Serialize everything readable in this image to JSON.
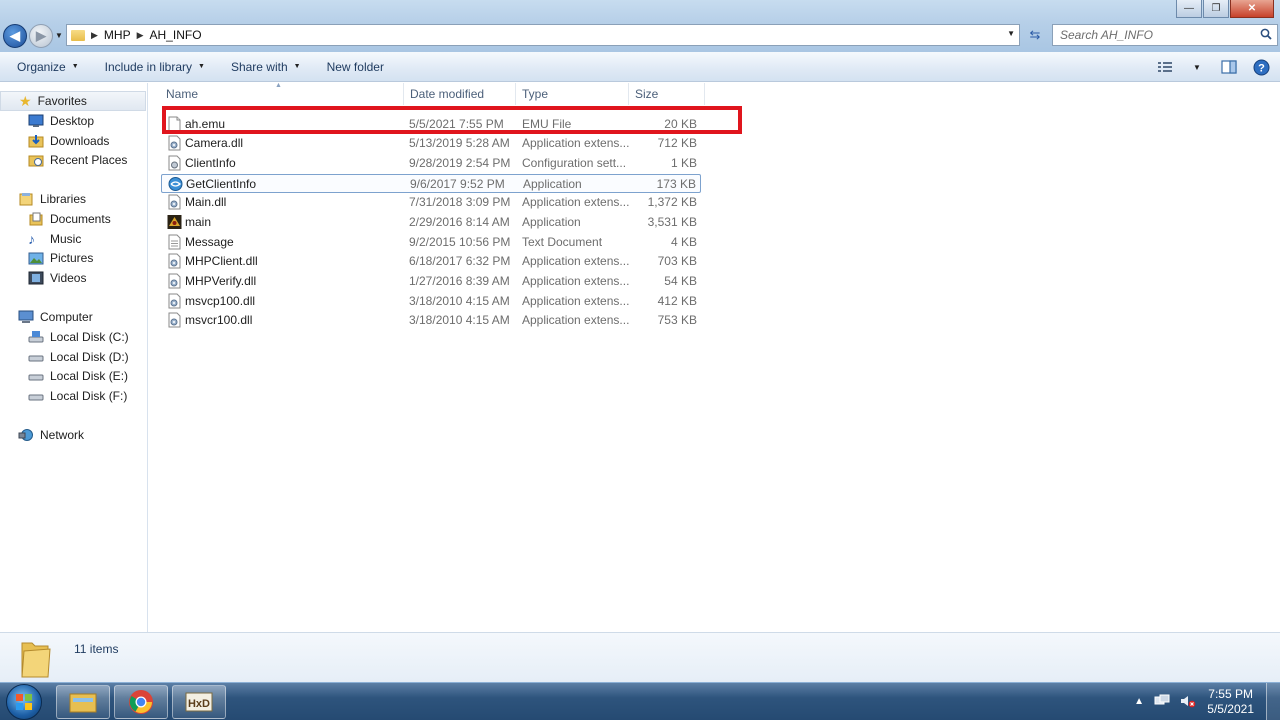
{
  "window": {
    "minimize_label": "—",
    "maximize_label": "❐",
    "close_label": "✕"
  },
  "address": {
    "crumbs": [
      "MHP",
      "AH_INFO"
    ],
    "search_placeholder": "Search AH_INFO"
  },
  "toolbar": {
    "organize": "Organize",
    "include_in_library": "Include in library",
    "share_with": "Share with",
    "new_folder": "New folder"
  },
  "nav": {
    "favorites": "Favorites",
    "desktop": "Desktop",
    "downloads": "Downloads",
    "recent_places": "Recent Places",
    "libraries": "Libraries",
    "documents": "Documents",
    "music": "Music",
    "pictures": "Pictures",
    "videos": "Videos",
    "computer": "Computer",
    "disk_c": "Local Disk (C:)",
    "disk_d": "Local Disk (D:)",
    "disk_e": "Local Disk (E:)",
    "disk_f": "Local Disk (F:)",
    "network": "Network"
  },
  "columns": {
    "name": "Name",
    "date": "Date modified",
    "type": "Type",
    "size": "Size"
  },
  "files": [
    {
      "name": "ah.emu",
      "date": "5/5/2021 7:55 PM",
      "type": "EMU File",
      "size": "20 KB",
      "icon": "blank-file-icon"
    },
    {
      "name": "Camera.dll",
      "date": "5/13/2019 5:28 AM",
      "type": "Application extens...",
      "size": "712 KB",
      "icon": "dll-icon"
    },
    {
      "name": "ClientInfo",
      "date": "9/28/2019 2:54 PM",
      "type": "Configuration sett...",
      "size": "1 KB",
      "icon": "config-icon"
    },
    {
      "name": "GetClientInfo",
      "date": "9/6/2017 9:52 PM",
      "type": "Application",
      "size": "173 KB",
      "icon": "globe-app-icon"
    },
    {
      "name": "Main.dll",
      "date": "7/31/2018 3:09 PM",
      "type": "Application extens...",
      "size": "1,372 KB",
      "icon": "dll-icon"
    },
    {
      "name": "main",
      "date": "2/29/2016 8:14 AM",
      "type": "Application",
      "size": "3,531 KB",
      "icon": "game-app-icon"
    },
    {
      "name": "Message",
      "date": "9/2/2015 10:56 PM",
      "type": "Text Document",
      "size": "4 KB",
      "icon": "text-file-icon"
    },
    {
      "name": "MHPClient.dll",
      "date": "6/18/2017 6:32 PM",
      "type": "Application extens...",
      "size": "703 KB",
      "icon": "dll-icon"
    },
    {
      "name": "MHPVerify.dll",
      "date": "1/27/2016 8:39 AM",
      "type": "Application extens...",
      "size": "54 KB",
      "icon": "dll-icon"
    },
    {
      "name": "msvcp100.dll",
      "date": "3/18/2010 4:15 AM",
      "type": "Application extens...",
      "size": "412 KB",
      "icon": "dll-icon"
    },
    {
      "name": "msvcr100.dll",
      "date": "3/18/2010 4:15 AM",
      "type": "Application extens...",
      "size": "753 KB",
      "icon": "dll-icon"
    }
  ],
  "details": {
    "item_count": "11 items"
  },
  "taskbar": {
    "time": "7:55 PM",
    "date": "5/5/2021"
  },
  "colors": {
    "highlight_box": "#e0151d",
    "link_text": "#1e3a5f"
  }
}
